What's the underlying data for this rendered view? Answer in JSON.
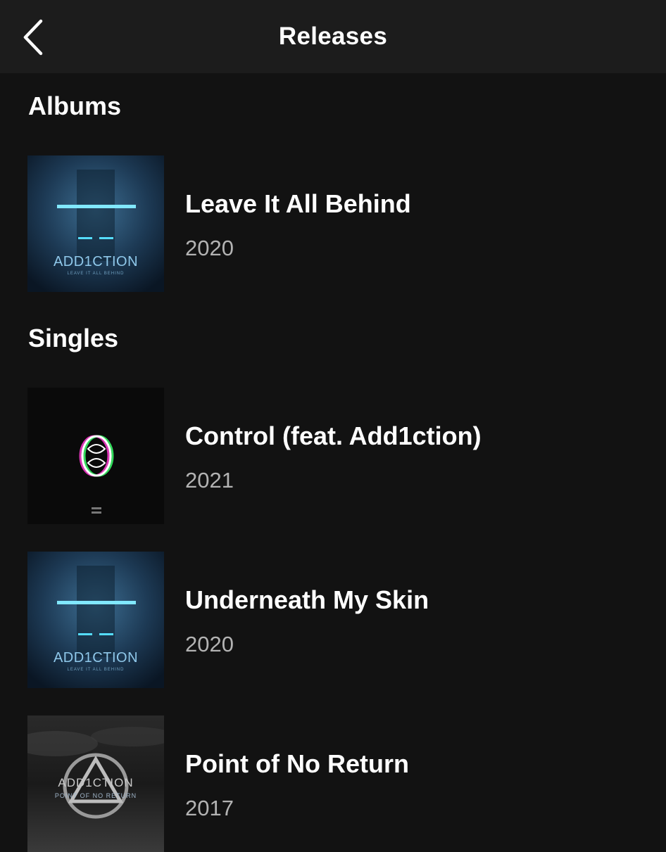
{
  "header": {
    "title": "Releases",
    "back_icon": "chevron-left-icon"
  },
  "albums": {
    "heading": "Albums",
    "items": [
      {
        "title": "Leave It All Behind",
        "year": "2020",
        "cover_text": "ADD1CTION",
        "cover_subtext": "LEAVE IT ALL BEHIND"
      }
    ]
  },
  "singles": {
    "heading": "Singles",
    "items": [
      {
        "title": "Control (feat. Add1ction)",
        "year": "2021",
        "cover_text": "",
        "cover_subtext": ""
      },
      {
        "title": "Underneath My Skin",
        "year": "2020",
        "cover_text": "ADD1CTION",
        "cover_subtext": "LEAVE IT ALL BEHIND"
      },
      {
        "title": "Point of No Return",
        "year": "2017",
        "cover_text": "ADD1CTION",
        "cover_subtext": "POINT OF NO RETURN"
      }
    ]
  },
  "colors": {
    "background": "#121212",
    "header_background": "#1c1c1c",
    "text_primary": "#ffffff",
    "text_secondary": "#b3b3b3",
    "cover_accent": "#3fd0ff"
  }
}
